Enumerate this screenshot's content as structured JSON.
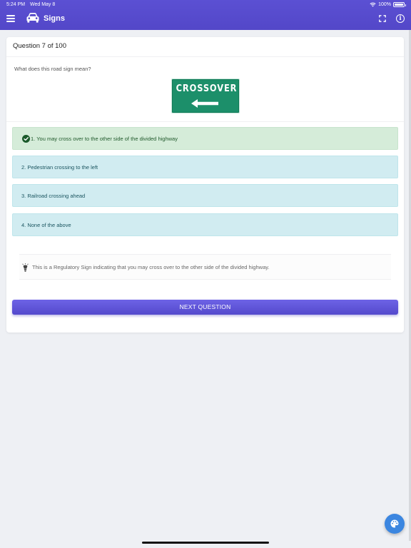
{
  "status_bar": {
    "time": "5:24 PM",
    "date": "Wed May 8",
    "battery": "100%"
  },
  "app_bar": {
    "title": "Signs",
    "accent_color": "#5347c8"
  },
  "question": {
    "header": "Question 7 of 100",
    "prompt": "What does this road sign mean?",
    "sign_text": "CROSSOVER"
  },
  "options": [
    {
      "label": "1. You may cross over to the other side of the divided highway",
      "state": "correct"
    },
    {
      "label": "2. Pedestrian crossing to the left",
      "state": "neutral"
    },
    {
      "label": "3. Railroad crossing ahead",
      "state": "neutral"
    },
    {
      "label": "4. None of the above",
      "state": "neutral"
    }
  ],
  "explanation": {
    "text": "This is a Regulatory Sign indicating that you may cross over to the other side of the divided highway.",
    "icon": "lightbulb-icon"
  },
  "actions": {
    "next_label": "NEXT QUESTION"
  },
  "colors": {
    "correct_bg": "#d5ecd9",
    "option_bg": "#d1ecf1",
    "sign_green": "#1c8f6a",
    "fab_blue": "#3b86e0"
  }
}
